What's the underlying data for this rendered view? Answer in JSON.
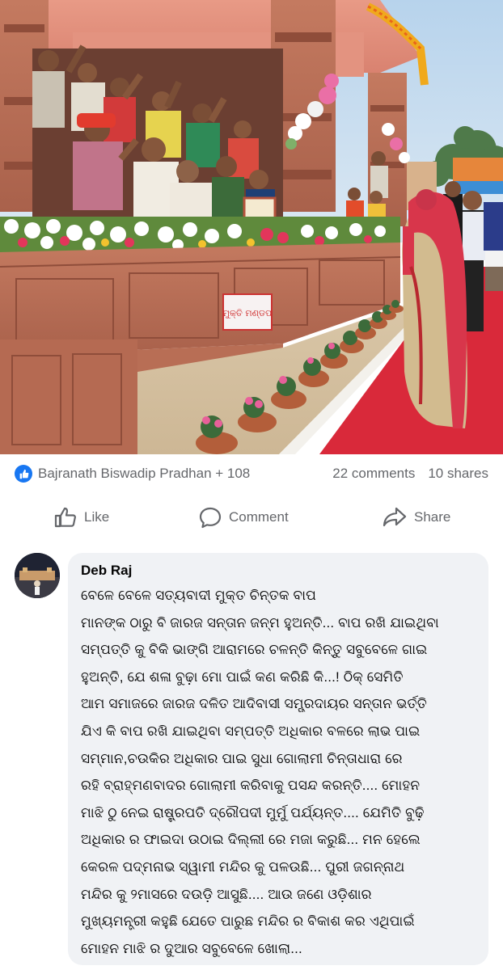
{
  "photo": {
    "description_icon": "photo-image",
    "signboard_text": "ମୁକ୍ତି ମଣ୍ଡପ"
  },
  "reactions": {
    "icon": "like-badge-icon",
    "names": "Bajranath Biswadip Pradhan + 108",
    "comments": "22 comments",
    "shares": "10 shares"
  },
  "actions": {
    "like": "Like",
    "comment": "Comment",
    "share": "Share"
  },
  "comment": {
    "author": "Deb Raj",
    "lines": [
      "ବେଳେ ବେଳେ ସତ୍ୟବାଦୀ ମୁକ୍ତ ଚିନ୍ତକ ବାପ",
      "ମାନଙ୍କ ଠାରୁ ବି ଜାରଜ ସନ୍ତାନ ଜନ୍ମ ହୁଅନ୍ତି... ବାପ ରଖି ଯାଇଥିବା",
      "ସମ୍ପତ୍ତି କୁ ବିକି ଭାଙ୍ଗି ଆରାମରେ ଚଳନ୍ତି କିନ୍ତୁ ସବୁବେଳେ ଗାଇ",
      "ହୁଅନ୍ତି, ଯେ ଶଳା ବୁଢ଼ା ମୋ ପାଇଁ କଣ କରିଛି କି...! ଠିକ୍ ସେମିତି",
      "ଆମ ସମାଜରେ ଜାରଜ ଦଳିତ ଆଦିବାସୀ ସମ୍ପ୍ରଦାୟର ସନ୍ତାନ ଭର୍ତ୍ତି",
      "ଯିଏ କି ବାପ ରଖି ଯାଇଥିବା ସମ୍ପତ୍ତି ଅଧିକାର ବଳରେ ଲାଭ ପାଇ",
      "ସମ୍ମାନ,ଚଉକିର ଅଧିକାର ପାଇ ସୁଧା ଗୋଲାମୀ ଚିନ୍ତାଧାରା ରେ",
      "ରହି ବ୍ରାହ୍ମଣବାଦର ଗୋଲାମୀ କରିବାକୁ ପସନ୍ଦ କରନ୍ତି.... ମୋହନ",
      "ମାଝି ଠୁ ନେଇ ରାଷ୍ଟ୍ରପତି ଦ୍ରୌପଦୀ ମୁର୍ମୁ ପର୍ଯ୍ୟନ୍ତ.... ଯେମିତି ବୁଢ଼ି",
      "ଅଧିକାର ର ଫାଇଦା ଉଠାଇ ଦିଲ୍ଲୀ ରେ ମଜା କରୁଛି... ମନ ହେଲେ",
      "କେରଳ ପଦ୍ମନାଭ ସ୍ୱାମୀ ମନ୍ଦିର କୁ ପଳଉଛି... ପୁରୀ ଜଗନ୍ନାଥ",
      "ମନ୍ଦିର କୁ ୨ମାସରେ ଦଉଡ଼ି ଆସୁଛି.... ଆଉ ଜଣେ ଓଡ଼ିଶାର",
      "ମୁଖ୍ୟମନ୍ତ୍ରୀ କହୁଛି ଯେତେ ପାରୁଛ ମନ୍ଦିର ର ବିକାଶ କର ଏଥିପାଇଁ",
      "ମୋହନ ମାଝି ର ଦୁଆର ସବୁବେଳେ ଖୋଲା..."
    ]
  },
  "colors": {
    "brand_blue": "#1877f2",
    "secondary_text": "#65676b",
    "bubble_bg": "#f0f2f5"
  }
}
